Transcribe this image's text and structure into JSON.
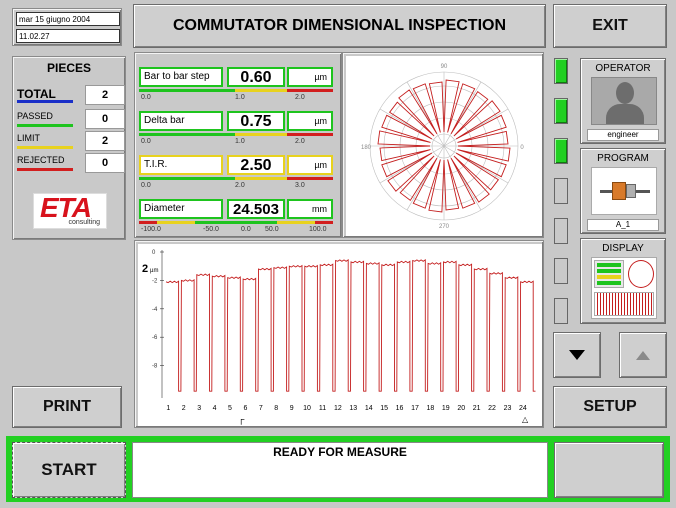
{
  "header": {
    "date": "mar 15 giugno 2004",
    "time": "11.02.27",
    "title": "COMMUTATOR DIMENSIONAL INSPECTION",
    "exit_label": "EXIT"
  },
  "pieces": {
    "title": "PIECES",
    "rows": [
      {
        "label": "TOTAL",
        "value": "2",
        "color": "#1a2fc8"
      },
      {
        "label": "PASSED",
        "value": "0",
        "color": "#1ec41e"
      },
      {
        "label": "LIMIT",
        "value": "2",
        "color": "#e8d21e"
      },
      {
        "label": "REJECTED",
        "value": "0",
        "color": "#d21e1e"
      }
    ]
  },
  "logo": {
    "text": "ETA",
    "sub": "consulting"
  },
  "measurements": [
    {
      "name": "Bar to bar step",
      "value": "0.60",
      "unit": "µm",
      "status": "ok",
      "ticks": [
        "0.0",
        "1.0",
        "2.0"
      ]
    },
    {
      "name": "Delta bar",
      "value": "0.75",
      "unit": "µm",
      "status": "ok",
      "ticks": [
        "0.0",
        "1.0",
        "2.0"
      ]
    },
    {
      "name": "T.I.R.",
      "value": "2.50",
      "unit": "µm",
      "status": "limit",
      "ticks": [
        "0.0",
        "2.0",
        "3.0"
      ]
    },
    {
      "name": "Diameter",
      "value": "24.503",
      "unit": "mm",
      "status": "ok",
      "ticks": [
        "-100.0",
        "-50.0",
        "0.0",
        "50.0",
        "100.0"
      ]
    }
  ],
  "polar": {
    "labels": {
      "top": "90",
      "left": "180",
      "right": "0",
      "bottom": "270"
    }
  },
  "profile": {
    "unit_label": "2",
    "unit_suffix": "µm",
    "y_ticks": [
      "0",
      "-2",
      "-4",
      "-6",
      "-8"
    ],
    "x_ticks": [
      "1",
      "2",
      "3",
      "4",
      "5",
      "6",
      "7",
      "8",
      "9",
      "10",
      "11",
      "12",
      "13",
      "14",
      "15",
      "16",
      "17",
      "18",
      "19",
      "20",
      "21",
      "22",
      "23",
      "24"
    ],
    "bar_tops": [
      -2.1,
      -2.0,
      -1.6,
      -1.7,
      -1.8,
      -1.9,
      -1.2,
      -1.1,
      -1.0,
      -1.0,
      -0.9,
      -0.6,
      -0.7,
      -0.8,
      -0.9,
      -0.7,
      -0.6,
      -0.8,
      -0.7,
      -0.9,
      -1.2,
      -1.5,
      -1.8,
      -2.1
    ],
    "bottom_value": -9.8
  },
  "side": {
    "operator_title": "OPERATOR",
    "operator_name": "engineer",
    "program_title": "PROGRAM",
    "program_name": "A_1",
    "display_title": "DISPLAY"
  },
  "leds": [
    true,
    true,
    true,
    false,
    false,
    false,
    false
  ],
  "buttons": {
    "print": "PRINT",
    "setup": "SETUP",
    "start": "START"
  },
  "status": {
    "message": "READY FOR MEASURE"
  }
}
